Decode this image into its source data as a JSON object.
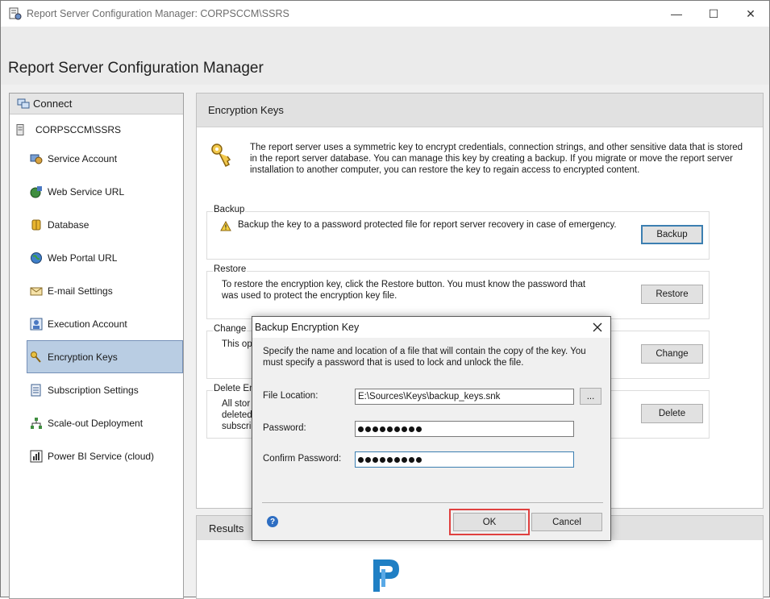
{
  "window": {
    "title": "Report Server Configuration Manager: CORPSCCM\\SSRS",
    "controls": {
      "minimize": "—",
      "maximize": "☐",
      "close": "✕"
    }
  },
  "header": {
    "title": "Report Server Configuration Manager"
  },
  "sidebar": {
    "connect_label": "Connect",
    "server": "CORPSCCM\\SSRS",
    "items": [
      {
        "label": "Service Account",
        "icon": "service-account-icon"
      },
      {
        "label": "Web Service URL",
        "icon": "web-service-icon"
      },
      {
        "label": "Database",
        "icon": "database-icon"
      },
      {
        "label": "Web Portal URL",
        "icon": "globe-icon"
      },
      {
        "label": "E-mail Settings",
        "icon": "email-icon"
      },
      {
        "label": "Execution Account",
        "icon": "execution-account-icon"
      },
      {
        "label": "Encryption Keys",
        "icon": "key-icon",
        "selected": true
      },
      {
        "label": "Subscription Settings",
        "icon": "subscription-icon"
      },
      {
        "label": "Scale-out Deployment",
        "icon": "scaleout-icon"
      },
      {
        "label": "Power BI Service (cloud)",
        "icon": "powerbi-icon"
      }
    ]
  },
  "main": {
    "title": "Encryption Keys",
    "intro": "The report server uses a symmetric key to encrypt credentials, connection strings, and other sensitive data that is stored in the report server database.  You can manage this key by creating a backup.  If you migrate or move the report server installation to another computer, you can restore the key to regain access to encrypted content.",
    "backup": {
      "legend": "Backup",
      "text": "Backup the key to a password protected file for report server recovery in case of emergency.",
      "button": "Backup"
    },
    "restore": {
      "legend": "Restore",
      "text": "To restore the encryption key, click the Restore button.  You must know the password that was used to protect the encryption key file.",
      "button": "Restore"
    },
    "change": {
      "legend": "Change",
      "text": "This op",
      "button": "Change"
    },
    "delete": {
      "legend": "Delete En",
      "text_lines": [
        "All stor",
        "deleted",
        "subscri"
      ],
      "button": "Delete"
    }
  },
  "results": {
    "title": "Results"
  },
  "dialog": {
    "title": "Backup Encryption Key",
    "description": "Specify the name and location of a file that will contain the copy of the key.  You must specify a password that is used to lock and unlock the file.",
    "file_location_label": "File Location:",
    "file_location_value": "E:\\Sources\\Keys\\backup_keys.snk",
    "browse_label": "...",
    "password_label": "Password:",
    "password_length": 9,
    "confirm_label": "Confirm Password:",
    "confirm_length": 9,
    "help": "?",
    "ok": "OK",
    "cancel": "Cancel"
  },
  "colors": {
    "accent": "#3c7fb1",
    "selected_bg": "#b9cde3",
    "highlight": "#e0403f"
  }
}
